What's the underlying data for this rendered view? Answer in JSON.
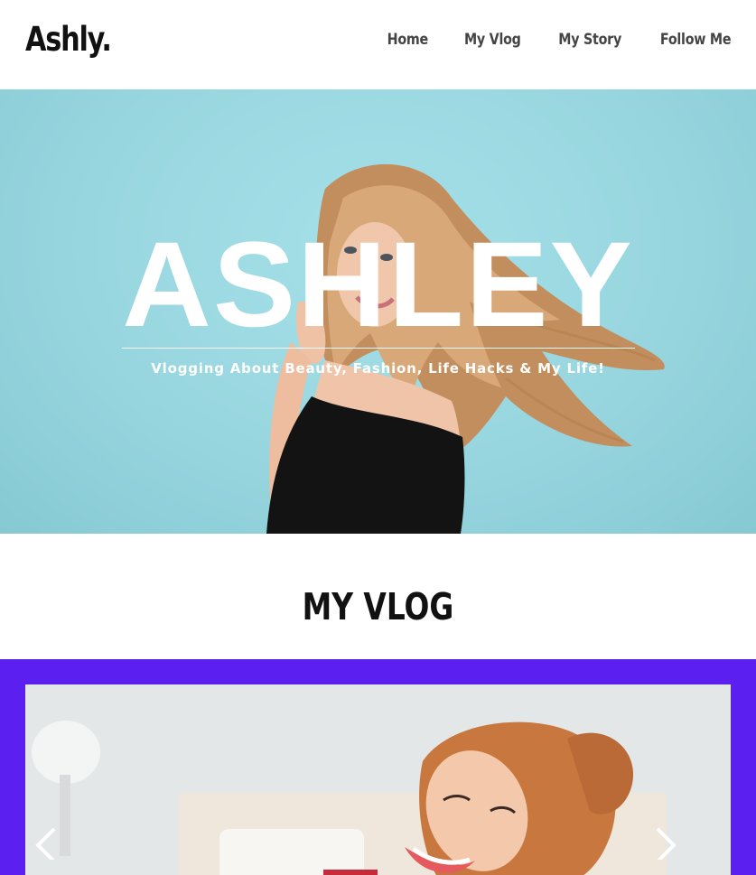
{
  "header": {
    "logo": "Ashly.",
    "nav": [
      {
        "label": "Home"
      },
      {
        "label": "My Vlog"
      },
      {
        "label": "My Story"
      },
      {
        "label": "Follow Me"
      }
    ]
  },
  "hero": {
    "title": "ASHLEY",
    "subtitle": "Vlogging About Beauty, Fashion, Life Hacks & My Life!",
    "background_color": "#98d6df"
  },
  "vlog": {
    "section_title": "MY VLOG",
    "band_color": "#5b1ff0",
    "prev_icon": "chevron-left-icon",
    "next_icon": "chevron-right-icon"
  }
}
